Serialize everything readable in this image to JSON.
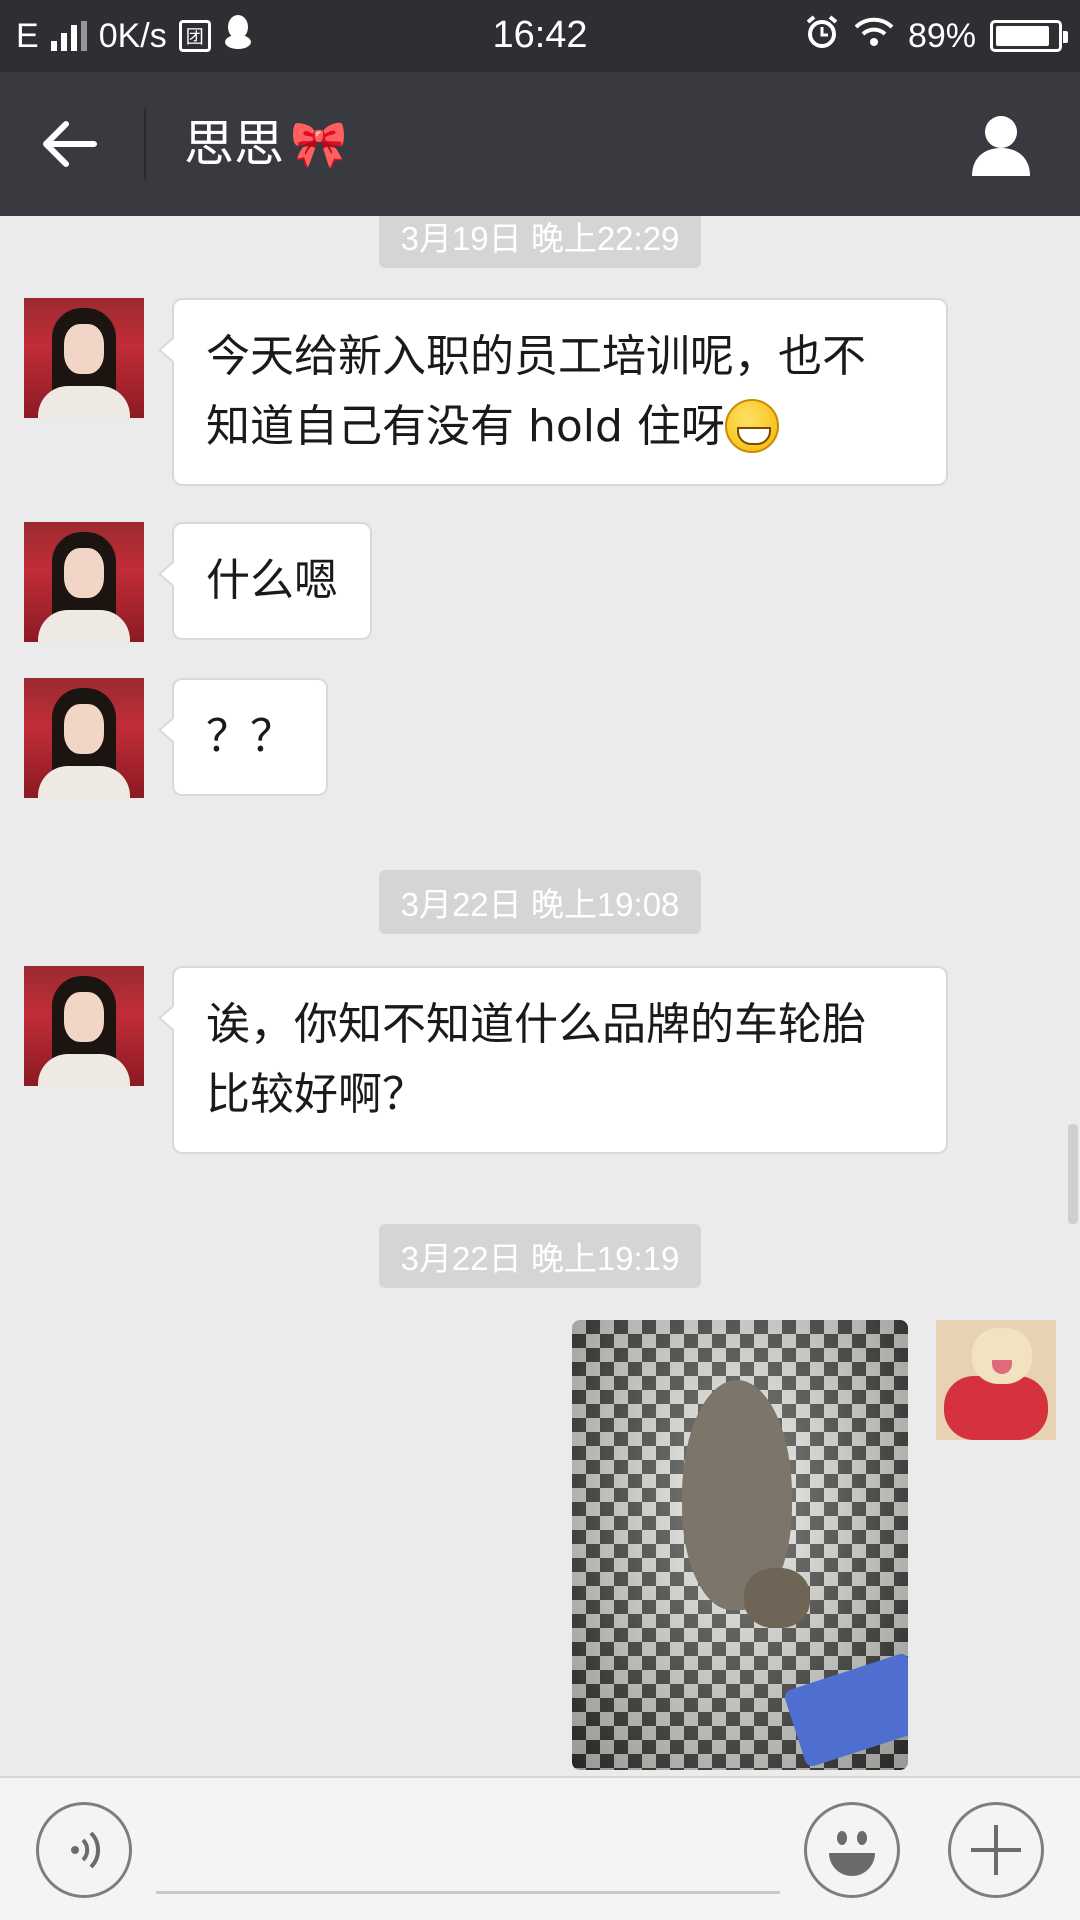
{
  "status_bar": {
    "network_type": "E",
    "speed": "0K/s",
    "app_badge": "团",
    "time": "16:42",
    "battery_text": "89%",
    "battery_level": 0.89,
    "icons": [
      "signal-icon",
      "qq-penguin-icon",
      "alarm-icon",
      "wifi-icon",
      "battery-icon"
    ]
  },
  "header": {
    "title": "思思",
    "title_emoji": "🎀",
    "back_icon": "arrow-left-icon",
    "profile_icon": "person-icon"
  },
  "messages": [
    {
      "type": "timestamp",
      "text": "3月19日 晚上22:29"
    },
    {
      "type": "received",
      "text": "今天给新入职的员工培训呢，也不",
      "text2": "知道自己有没有 hold 住呀",
      "emoji": "grinning-emoji"
    },
    {
      "type": "received",
      "text": "什么嗯"
    },
    {
      "type": "received",
      "text": "？？"
    },
    {
      "type": "timestamp",
      "text": "3月22日 晚上19:08"
    },
    {
      "type": "received",
      "text": "诶，你知不知道什么品牌的车轮胎",
      "text2": "比较好啊？"
    },
    {
      "type": "timestamp",
      "text": "3月22日 晚上19:19"
    },
    {
      "type": "sent-image",
      "image": "cat-on-tile-floor-photo"
    }
  ],
  "input_bar": {
    "voice_icon": "voice-icon",
    "emoji_icon": "smiley-icon",
    "plus_icon": "plus-icon",
    "placeholder": ""
  },
  "colors": {
    "status_bar": "#2e2f33",
    "title_bar": "#393a3f",
    "chat_bg": "#ebebeb",
    "bubble_received": "#ffffff",
    "timestamp_bg": "#d5d5d5"
  }
}
